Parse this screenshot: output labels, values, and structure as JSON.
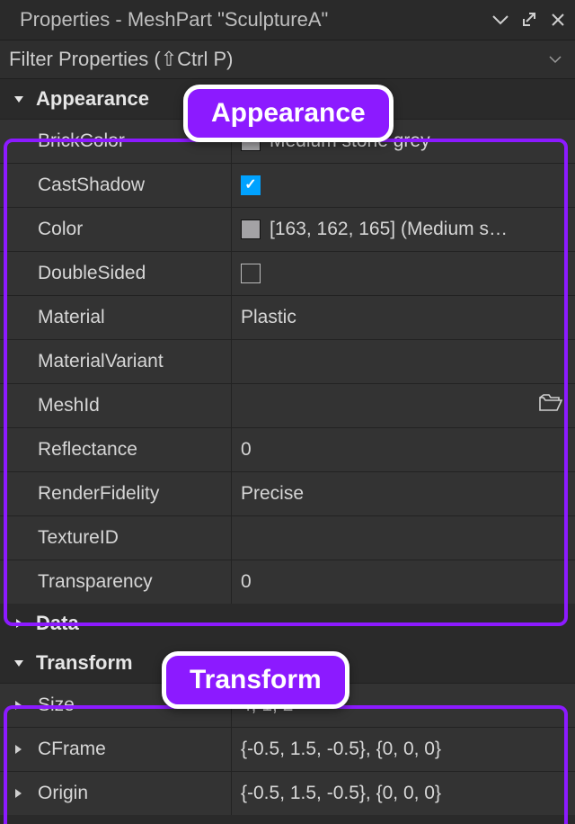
{
  "colors": {
    "accent": "#8c1aff",
    "checkbox_on": "#00a2ff",
    "swatch": "#a3a2a5"
  },
  "window": {
    "title": "Properties - MeshPart \"SculptureA\""
  },
  "filter": {
    "placeholder": "Filter Properties (⇧Ctrl P)"
  },
  "badges": {
    "appearance": "Appearance",
    "transform": "Transform"
  },
  "sections": {
    "appearance": {
      "label": "Appearance",
      "expanded": true
    },
    "data": {
      "label": "Data",
      "expanded": false
    },
    "transform": {
      "label": "Transform",
      "expanded": true
    }
  },
  "appearance_props": {
    "brickcolor_label": "BrickColor",
    "brickcolor_value": "Medium stone grey",
    "castshadow_label": "CastShadow",
    "castshadow_checked": true,
    "color_label": "Color",
    "color_value": "[163, 162, 165] (Medium s…",
    "doublesided_label": "DoubleSided",
    "doublesided_checked": false,
    "material_label": "Material",
    "material_value": "Plastic",
    "materialvariant_label": "MaterialVariant",
    "materialvariant_value": "",
    "meshid_label": "MeshId",
    "meshid_value": "",
    "reflectance_label": "Reflectance",
    "reflectance_value": "0",
    "renderfidelity_label": "RenderFidelity",
    "renderfidelity_value": "Precise",
    "textureid_label": "TextureID",
    "textureid_value": "",
    "transparency_label": "Transparency",
    "transparency_value": "0"
  },
  "transform_props": {
    "size_label": "Size",
    "size_value": "4, 1, 2",
    "cframe_label": "CFrame",
    "cframe_value": "{-0.5, 1.5, -0.5}, {0, 0, 0}",
    "origin_label": "Origin",
    "origin_value": "{-0.5, 1.5, -0.5}, {0, 0, 0}"
  }
}
